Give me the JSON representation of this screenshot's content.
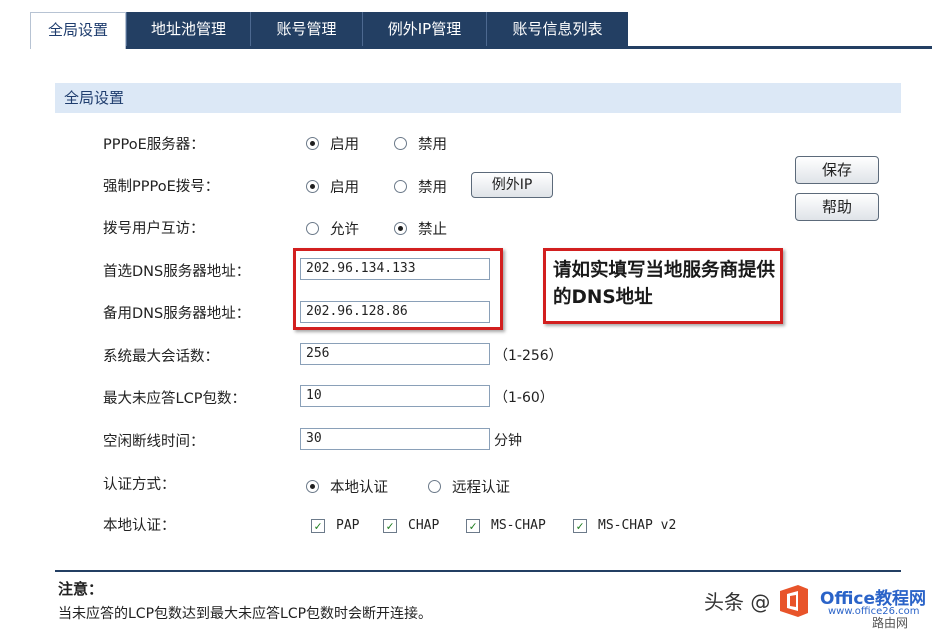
{
  "tabs": [
    {
      "label": "全局设置",
      "active": true
    },
    {
      "label": "地址池管理",
      "active": false
    },
    {
      "label": "账号管理",
      "active": false
    },
    {
      "label": "例外IP管理",
      "active": false
    },
    {
      "label": "账号信息列表",
      "active": false
    }
  ],
  "section_title": "全局设置",
  "settings": {
    "pppoe_server": {
      "label": "PPPoE服务器：",
      "opt1": "启用",
      "opt2": "禁用",
      "selected": "启用"
    },
    "force_pppoe": {
      "label": "强制PPPoE拨号：",
      "opt1": "启用",
      "opt2": "禁用",
      "selected": "启用",
      "button": "例外IP"
    },
    "dial_user_access": {
      "label": "拨号用户互访：",
      "opt1": "允许",
      "opt2": "禁止",
      "selected": "禁止"
    },
    "primary_dns": {
      "label": "首选DNS服务器地址：",
      "value": "202.96.134.133"
    },
    "backup_dns": {
      "label": "备用DNS服务器地址：",
      "value": "202.96.128.86"
    },
    "max_sessions": {
      "label": "系统最大会话数：",
      "value": "256",
      "hint": "（1-256）"
    },
    "max_lcp": {
      "label": "最大未应答LCP包数：",
      "value": "10",
      "hint": "（1-60）"
    },
    "idle_timeout": {
      "label": "空闲断线时间：",
      "value": "30",
      "unit": "分钟"
    },
    "auth_method": {
      "label": "认证方式：",
      "opt1": "本地认证",
      "opt2": "远程认证",
      "selected": "本地认证"
    },
    "local_auth": {
      "label": "本地认证：",
      "items": [
        "PAP",
        "CHAP",
        "MS-CHAP",
        "MS-CHAP v2"
      ]
    }
  },
  "buttons": {
    "save": "保存",
    "help": "帮助"
  },
  "callout": "请如实填写当地服务商提供的DNS地址",
  "note": {
    "title": "注意：",
    "text": "当未应答的LCP包数达到最大未应答LCP包数时会断开连接。"
  },
  "watermark": {
    "author": "头条 @",
    "brand": "Office教程网",
    "url": "www.office26.com",
    "site": "路由网"
  },
  "colors": {
    "tab_dark": "#233f63",
    "section_bg": "#dce8f6",
    "callout_border": "#d21f1f"
  }
}
